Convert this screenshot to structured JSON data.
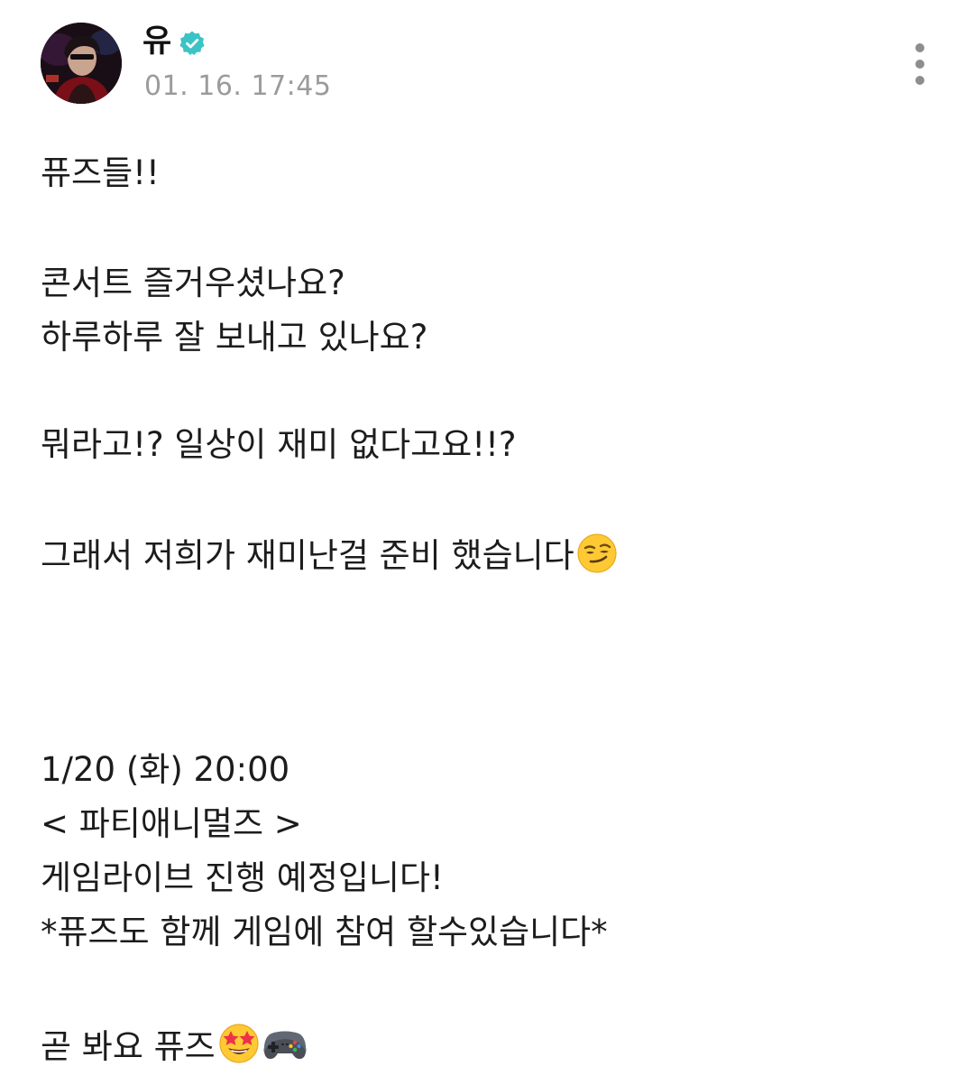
{
  "post": {
    "author": "유",
    "timestamp": "01. 16. 17:45",
    "lines": {
      "greeting": "퓨즈들!!",
      "concert": "콘서트 즐거우셨나요?",
      "daily": "하루하루 잘 보내고 있나요?",
      "what": "뭐라고!? 일상이 재미 없다고요!!?",
      "prepared": "그래서 저희가 재미난걸 준비 했습니다",
      "date": "1/20 (화) 20:00",
      "show": "< 파티애니멀즈 >",
      "live": "게임라이브 진행 예정입니다!",
      "join": "*퓨즈도 함께 게임에 참여 할수있습니다*",
      "closing": "곧 봐요 퓨즈"
    },
    "icons": {
      "verified": "verified-badge-icon",
      "more": "more-vertical-icon",
      "smirk": "smirking-face-emoji",
      "starstruck": "star-struck-emoji",
      "gamepad": "video-game-controller-emoji"
    }
  },
  "colors": {
    "verified": "#3cc3c6",
    "timestamp": "#9b9b9b",
    "text": "#1c1c1c"
  }
}
